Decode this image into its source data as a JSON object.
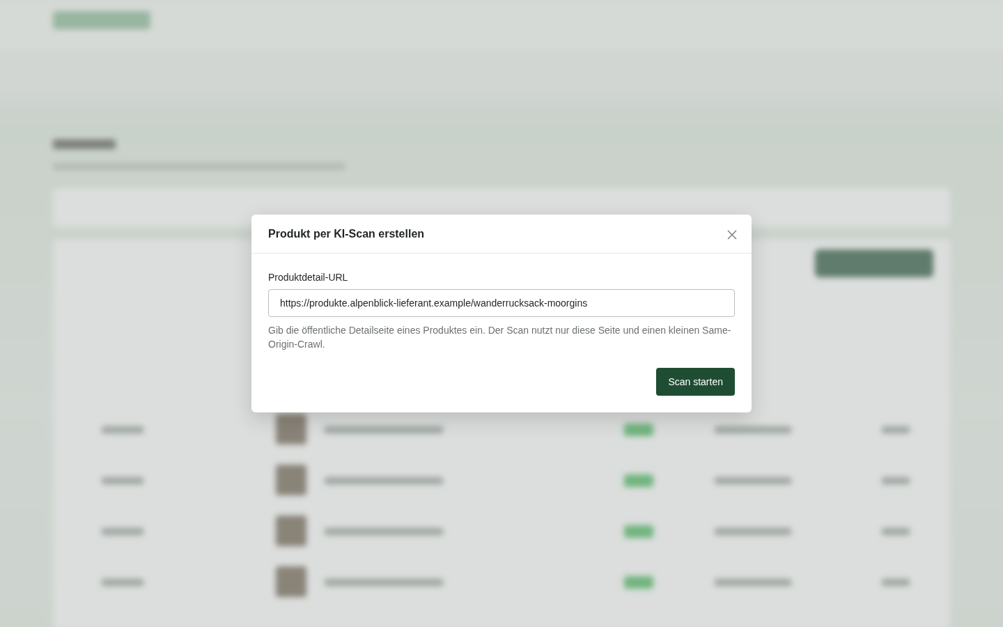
{
  "dialog": {
    "title": "Produkt per KI-Scan erstellen",
    "field": {
      "label": "Produktdetail-URL",
      "value": "https://produkte.alpenblick-lieferant.example/wanderrucksack-moorgins"
    },
    "help": "Gib die öffentliche Detailseite eines Produktes ein. Der Scan nutzt nur diese Seite und einen kleinen Same-Origin-Crawl.",
    "button": "Scan starten"
  }
}
